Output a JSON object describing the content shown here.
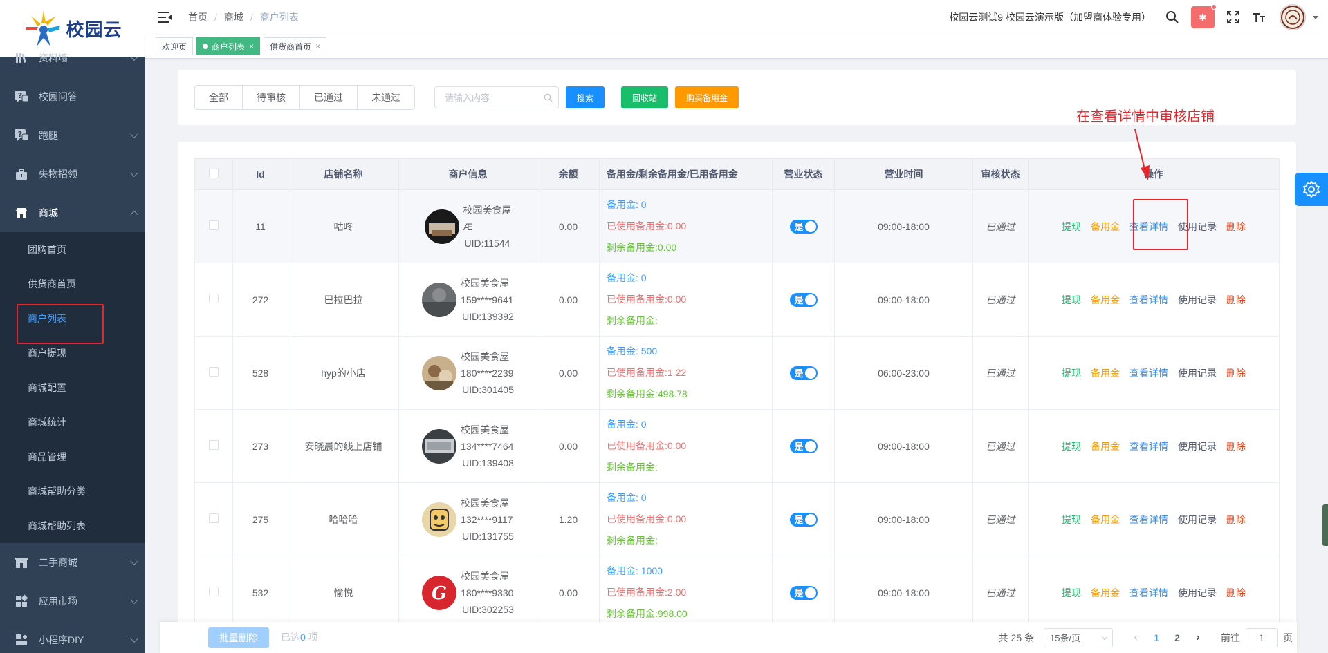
{
  "brand": {
    "name": "校园云"
  },
  "sidebar": {
    "items": [
      {
        "label": "资料墙",
        "icon": "books-icon",
        "expandable": true
      },
      {
        "label": "校园问答",
        "icon": "question-chat-icon",
        "expandable": false
      },
      {
        "label": "跑腿",
        "icon": "question-chat-icon",
        "expandable": true
      },
      {
        "label": "失物招领",
        "icon": "briefcase-icon",
        "expandable": true
      },
      {
        "label": "商城",
        "icon": "shop-icon",
        "expandable": true,
        "expanded": true
      }
    ],
    "submenu": [
      {
        "label": "团购首页"
      },
      {
        "label": "供货商首页"
      },
      {
        "label": "商户列表",
        "active": true
      },
      {
        "label": "商户提现"
      },
      {
        "label": "商城配置"
      },
      {
        "label": "商城统计"
      },
      {
        "label": "商品管理"
      },
      {
        "label": "商城帮助分类"
      },
      {
        "label": "商城帮助列表"
      }
    ],
    "items_after": [
      {
        "label": "二手商城",
        "icon": "store-icon"
      },
      {
        "label": "应用市场",
        "icon": "apps-grid-icon"
      },
      {
        "label": "小程序DIY",
        "icon": "diy-icon"
      }
    ]
  },
  "header": {
    "breadcrumb": [
      "首页",
      "商城",
      "商户列表"
    ],
    "school_name": "校园云测试9 校园云演示版（加盟商体验专用）"
  },
  "tags": [
    {
      "label": "欢迎页",
      "active": false,
      "closable": false
    },
    {
      "label": "商户列表",
      "active": true,
      "closable": true
    },
    {
      "label": "供货商首页",
      "active": false,
      "closable": true
    }
  ],
  "filters": {
    "segments": [
      "全部",
      "待审核",
      "已通过",
      "未通过"
    ],
    "search_placeholder": "请输入内容",
    "search_btn": "搜索",
    "recycle_btn": "回收站",
    "buy_btn": "购买备用金"
  },
  "annotation": "在查看详情中审核店铺",
  "table": {
    "columns": [
      "Id",
      "店铺名称",
      "商户信息",
      "余额",
      "备用金/剩余备用金/已用备用金",
      "营业状态",
      "营业时间",
      "审核状态",
      "操作"
    ],
    "rows": [
      {
        "id": "11",
        "shop": "咕咚",
        "m_name": "校园美食屋",
        "m_phone": "Æ",
        "m_uid": "UID:11544",
        "balance": "0.00",
        "f1": "备用金: 0",
        "f2": "已使用备用金:0.00",
        "f3": "剩余备用金:0.00",
        "switch": "是",
        "hours": "09:00-18:00",
        "status": "已通过",
        "avatar": "a1"
      },
      {
        "id": "272",
        "shop": "巴拉巴拉",
        "m_name": "校园美食屋",
        "m_phone": "159****9641",
        "m_uid": "UID:139392",
        "balance": "0.00",
        "f1": "备用金: 0",
        "f2": "已使用备用金:0.00",
        "f3": "剩余备用金:",
        "switch": "是",
        "hours": "09:00-18:00",
        "status": "已通过",
        "avatar": "a2"
      },
      {
        "id": "528",
        "shop": "hyp的小店",
        "m_name": "校园美食屋",
        "m_phone": "180****2239",
        "m_uid": "UID:301405",
        "balance": "0.00",
        "f1": "备用金: 500",
        "f2": "已使用备用金:1.22",
        "f3": "剩余备用金:498.78",
        "switch": "是",
        "hours": "06:00-23:00",
        "status": "已通过",
        "avatar": "a3"
      },
      {
        "id": "273",
        "shop": "安晓晨的线上店铺",
        "m_name": "校园美食屋",
        "m_phone": "134****7464",
        "m_uid": "UID:139408",
        "balance": "0.00",
        "f1": "备用金: 0",
        "f2": "已使用备用金:0.00",
        "f3": "剩余备用金:",
        "switch": "是",
        "hours": "09:00-18:00",
        "status": "已通过",
        "avatar": "a4"
      },
      {
        "id": "275",
        "shop": "哈哈哈",
        "m_name": "校园美食屋",
        "m_phone": "132****9117",
        "m_uid": "UID:131755",
        "balance": "1.20",
        "f1": "备用金: 0",
        "f2": "已使用备用金:0.00",
        "f3": "剩余备用金:",
        "switch": "是",
        "hours": "09:00-18:00",
        "status": "已通过",
        "avatar": "a5"
      },
      {
        "id": "532",
        "shop": "愉悦",
        "m_name": "校园美食屋",
        "m_phone": "180****9330",
        "m_uid": "UID:302253",
        "balance": "0.00",
        "f1": "备用金: 1000",
        "f2": "已使用备用金:2.00",
        "f3": "剩余备用金:998.00",
        "switch": "是",
        "hours": "09:00-18:00",
        "status": "已通过",
        "avatar": "a6"
      }
    ],
    "ops": [
      "提现",
      "备用金",
      "查看详情",
      "使用记录",
      "删除"
    ]
  },
  "footer": {
    "batch_delete": "批量删除",
    "selected_prefix": "已选",
    "selected_count": "0",
    "selected_suffix": "项",
    "total": "共 25 条",
    "page_size": "15条/页",
    "pages": [
      "1",
      "2"
    ],
    "current_page": "1",
    "goto_label": "前往",
    "goto_value": "1",
    "goto_suffix": "页"
  },
  "colors": {
    "sidebar": "#304156",
    "accent": "#409eff",
    "annotation": "#e8252b"
  }
}
